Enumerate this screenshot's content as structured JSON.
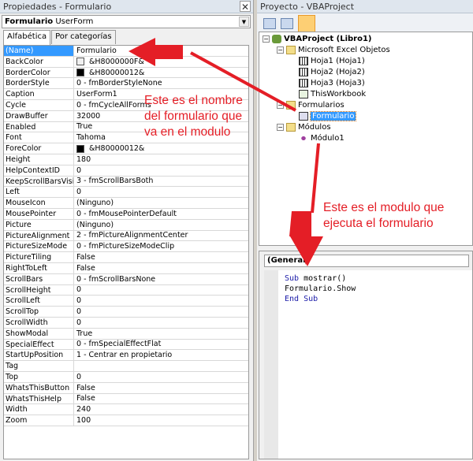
{
  "properties": {
    "title": "Propiedades - Formulario",
    "close_label": "✕",
    "object_name": "Formulario",
    "object_type": "UserForm",
    "tabs": [
      "Alfabética",
      "Por categorías"
    ],
    "rows": [
      {
        "name": "(Name)",
        "value": "Formulario",
        "selected": true
      },
      {
        "name": "BackColor",
        "value": "&H8000000F&",
        "swatch": "#f0f0f0"
      },
      {
        "name": "BorderColor",
        "value": "&H80000012&",
        "swatch": "#000000"
      },
      {
        "name": "BorderStyle",
        "value": "0 - fmBorderStyleNone"
      },
      {
        "name": "Caption",
        "value": "UserForm1"
      },
      {
        "name": "Cycle",
        "value": "0 - fmCycleAllForms"
      },
      {
        "name": "DrawBuffer",
        "value": "32000"
      },
      {
        "name": "Enabled",
        "value": "True"
      },
      {
        "name": "Font",
        "value": "Tahoma"
      },
      {
        "name": "ForeColor",
        "value": "&H80000012&",
        "swatch": "#000000"
      },
      {
        "name": "Height",
        "value": "180"
      },
      {
        "name": "HelpContextID",
        "value": "0"
      },
      {
        "name": "KeepScrollBarsVisible",
        "value": "3 - fmScrollBarsBoth"
      },
      {
        "name": "Left",
        "value": "0"
      },
      {
        "name": "MouseIcon",
        "value": "(Ninguno)"
      },
      {
        "name": "MousePointer",
        "value": "0 - fmMousePointerDefault"
      },
      {
        "name": "Picture",
        "value": "(Ninguno)"
      },
      {
        "name": "PictureAlignment",
        "value": "2 - fmPictureAlignmentCenter"
      },
      {
        "name": "PictureSizeMode",
        "value": "0 - fmPictureSizeModeClip"
      },
      {
        "name": "PictureTiling",
        "value": "False"
      },
      {
        "name": "RightToLeft",
        "value": "False"
      },
      {
        "name": "ScrollBars",
        "value": "0 - fmScrollBarsNone"
      },
      {
        "name": "ScrollHeight",
        "value": "0"
      },
      {
        "name": "ScrollLeft",
        "value": "0"
      },
      {
        "name": "ScrollTop",
        "value": "0"
      },
      {
        "name": "ScrollWidth",
        "value": "0"
      },
      {
        "name": "ShowModal",
        "value": "True"
      },
      {
        "name": "SpecialEffect",
        "value": "0 - fmSpecialEffectFlat"
      },
      {
        "name": "StartUpPosition",
        "value": "1 - Centrar en propietario"
      },
      {
        "name": "Tag",
        "value": ""
      },
      {
        "name": "Top",
        "value": "0"
      },
      {
        "name": "WhatsThisButton",
        "value": "False"
      },
      {
        "name": "WhatsThisHelp",
        "value": "False"
      },
      {
        "name": "Width",
        "value": "240"
      },
      {
        "name": "Zoom",
        "value": "100"
      }
    ]
  },
  "project": {
    "title": "Proyecto - VBAProject",
    "tree": {
      "root": "VBAProject (Libro1)",
      "excel_objects": "Microsoft Excel Objetos",
      "sheets": [
        "Hoja1 (Hoja1)",
        "Hoja2 (Hoja2)",
        "Hoja3 (Hoja3)"
      ],
      "workbook": "ThisWorkbook",
      "forms_folder": "Formularios",
      "form": "Formulario",
      "modules_folder": "Módulos",
      "module": "Módulo1"
    }
  },
  "code": {
    "object_combo": "(General)",
    "lines": {
      "l1_kw": "Sub",
      "l1_rest": " mostrar()",
      "l2": "Formulario.Show",
      "l3": "End Sub"
    }
  },
  "annotations": {
    "name_note": [
      "Este es el nombre",
      "del formulario que",
      "va en el modulo"
    ],
    "module_note": [
      "Este es el modulo que",
      "ejecuta el formulario"
    ],
    "color": "#e41e26"
  }
}
